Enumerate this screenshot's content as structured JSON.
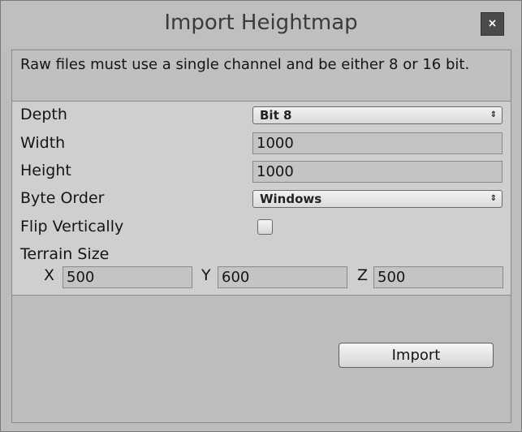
{
  "window": {
    "title": "Import Heightmap",
    "close_glyph": "×"
  },
  "info": {
    "message": "Raw files must use a single channel and be either 8 or 16 bit."
  },
  "settings": {
    "depth_label": "Depth",
    "depth_value": "Bit 8",
    "width_label": "Width",
    "width_value": "1000",
    "height_label": "Height",
    "height_value": "1000",
    "byte_order_label": "Byte Order",
    "byte_order_value": "Windows",
    "flip_label": "Flip Vertically",
    "flip_checked": false,
    "terrain_size_label": "Terrain Size",
    "terrain_x_label": "X",
    "terrain_x_value": "500",
    "terrain_y_label": "Y",
    "terrain_y_value": "600",
    "terrain_z_label": "Z",
    "terrain_z_value": "500"
  },
  "actions": {
    "import_label": "Import"
  },
  "icons": {
    "dropdown_arrow": "⇕"
  },
  "colors": {
    "titlebar": "#bfbfbf",
    "close_button": "#4a4a4a",
    "panel": "#cfcfcf"
  }
}
